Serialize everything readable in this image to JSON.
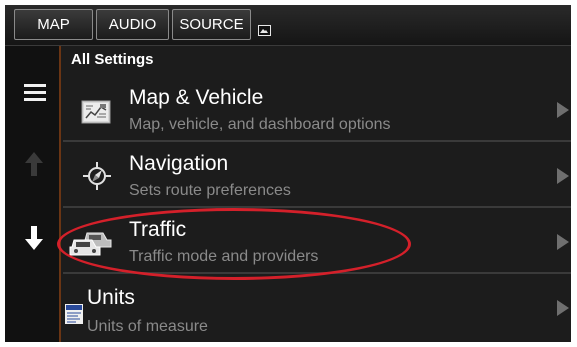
{
  "topbar": {
    "tabs": [
      {
        "label": "MAP"
      },
      {
        "label": "AUDIO"
      },
      {
        "label": "SOURCE"
      }
    ],
    "photo_icon": "photo-icon"
  },
  "header": {
    "title": "All Settings"
  },
  "rail": {
    "menu_icon": "menu-icon",
    "up_icon": "arrow-up-icon",
    "down_icon": "arrow-down-icon"
  },
  "settings": [
    {
      "title": "Map & Vehicle",
      "subtitle": "Map, vehicle, and dashboard options",
      "icon": "map-icon"
    },
    {
      "title": "Navigation",
      "subtitle": "Sets route preferences",
      "icon": "compass-icon"
    },
    {
      "title": "Traffic",
      "subtitle": "Traffic mode and providers",
      "icon": "traffic-cars-icon"
    },
    {
      "title": "Units",
      "subtitle": "Units of measure",
      "icon": "units-icon"
    }
  ],
  "colors": {
    "background": "#1c1c1c",
    "rail_accent": "#6a3514",
    "highlight": "#d4202a",
    "subtitle": "#8a8a8a"
  }
}
